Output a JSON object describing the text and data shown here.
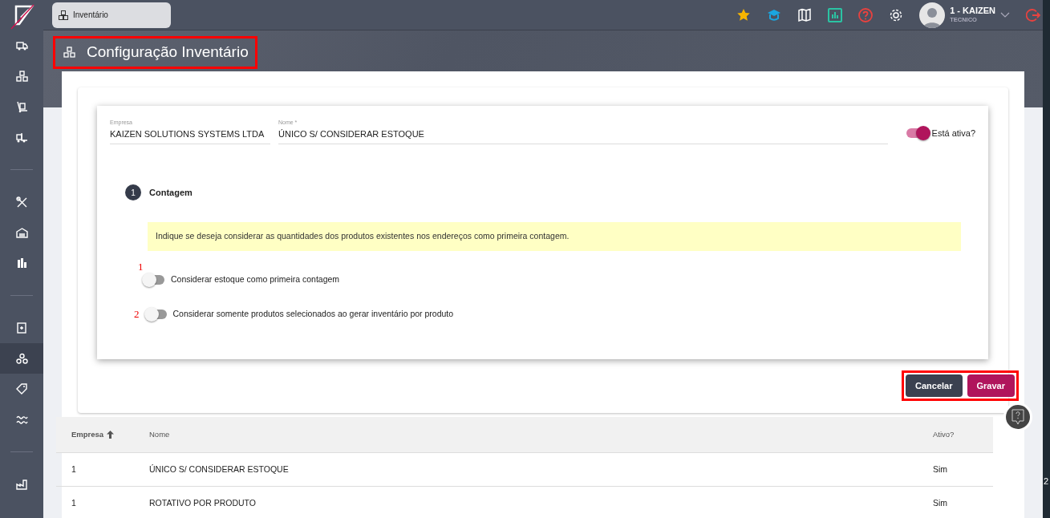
{
  "sidebar": {
    "items": [
      {
        "kind": "truck",
        "selected": false
      },
      {
        "kind": "boxes",
        "selected": false
      },
      {
        "kind": "dolly",
        "selected": false
      },
      {
        "kind": "forklift",
        "selected": false
      },
      {
        "kind": "divider"
      },
      {
        "kind": "tools",
        "selected": false
      },
      {
        "kind": "warehouse",
        "selected": false
      },
      {
        "kind": "chart",
        "selected": false
      },
      {
        "kind": "divider"
      },
      {
        "kind": "document",
        "selected": false
      },
      {
        "kind": "circles",
        "selected": true
      },
      {
        "kind": "tag",
        "selected": false
      },
      {
        "kind": "wave",
        "selected": false
      },
      {
        "kind": "divider"
      },
      {
        "kind": "factory",
        "selected": false
      }
    ]
  },
  "tabs": [
    {
      "label": "Inventário",
      "selected": true
    }
  ],
  "topbar": {
    "user": {
      "name": "1 - KAIZEN",
      "role": "TECNICO"
    }
  },
  "page_title": {
    "text": "Configuração Inventário",
    "highlighted": true
  },
  "form": {
    "empresa": {
      "label": "Empresa",
      "value": "KAIZEN SOLUTIONS SYSTEMS LTDA"
    },
    "nome": {
      "label": "Nome *",
      "value": "ÚNICO S/ CONSIDERAR ESTOQUE"
    },
    "ativa": {
      "label": "Está ativa?",
      "on": true
    },
    "step": {
      "number": "1",
      "title": "Contagem"
    },
    "hint": "Indique se deseja considerar as quantidades dos produtos existentes nos endereços como primeira contagem.",
    "options": [
      {
        "marker": "1",
        "label": "Considerar estoque como primeira contagem",
        "on": false
      },
      {
        "marker": "2",
        "label": "Considerar somente produtos selecionados ao gerar inventário por produto",
        "on": false
      }
    ],
    "buttons": [
      {
        "label": "Cancelar",
        "kind": "secondary"
      },
      {
        "label": "Gravar",
        "kind": "primary"
      }
    ],
    "buttons_highlighted": true
  },
  "table": {
    "columns": [
      {
        "label": "Empresa",
        "sorted": true
      },
      {
        "label": "Nome",
        "sorted": false
      },
      {
        "label": "Ativo?",
        "sorted": false
      }
    ],
    "rows": [
      [
        "1",
        "ÚNICO S/ CONSIDERAR ESTOQUE",
        "Sim"
      ],
      [
        "1",
        "ROTATIVO POR PRODUTO",
        "Sim"
      ]
    ]
  },
  "edge_text": "2"
}
